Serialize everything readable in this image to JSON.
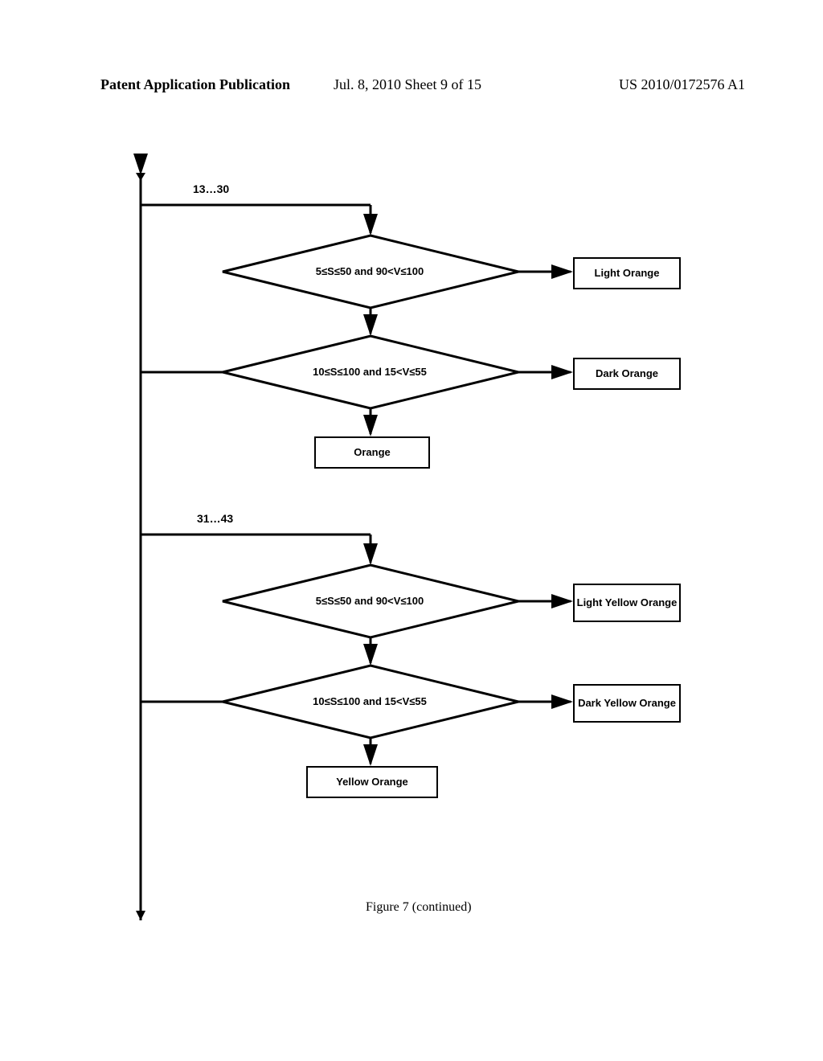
{
  "header": {
    "left": "Patent Application Publication",
    "mid": "Jul. 8, 2010  Sheet 9 of 15",
    "right": "US 2010/0172576 A1"
  },
  "branch1": {
    "range_label": "13…30",
    "diamond1": "5≤S≤50 and 90<V≤100",
    "result1": "Light Orange",
    "diamond2": "10≤S≤100 and 15<V≤55",
    "result2": "Dark Orange",
    "default": "Orange"
  },
  "branch2": {
    "range_label": "31…43",
    "diamond1": "5≤S≤50 and 90<V≤100",
    "result1": "Light Yellow Orange",
    "diamond2": "10≤S≤100 and 15<V≤55",
    "result2": "Dark Yellow Orange",
    "default": "Yellow Orange"
  },
  "caption": "Figure 7 (continued)"
}
